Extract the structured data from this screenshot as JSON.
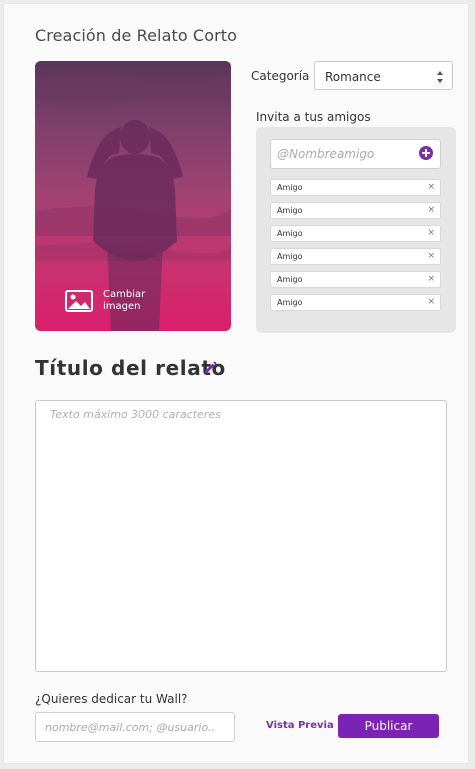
{
  "app": {
    "title": "Creación de Relato Corto"
  },
  "cover": {
    "change_label_line1": "Cambiar",
    "change_label_line2": "imagen"
  },
  "category": {
    "label": "Categoría",
    "selected": "Romance"
  },
  "invite": {
    "label": "Invita a tus amigos",
    "input_placeholder": "@Nombreamigo",
    "friends": [
      "Amigo",
      "Amigo",
      "Amigo",
      "Amigo",
      "Amigo",
      "Amigo"
    ],
    "remove_glyph": "×"
  },
  "story": {
    "title": "Título del relato",
    "text_placeholder": "Texto máximo 3000 caracteres"
  },
  "dedicate": {
    "label": "¿Quieres dedicar tu Wall?",
    "input_placeholder": "nombre@mail.com; @usuario.."
  },
  "actions": {
    "preview_label": "Vista Previa",
    "publish_label": "Publicar"
  },
  "colors": {
    "accent": "#7a23b4",
    "cover_bottom": "#d8236e"
  }
}
